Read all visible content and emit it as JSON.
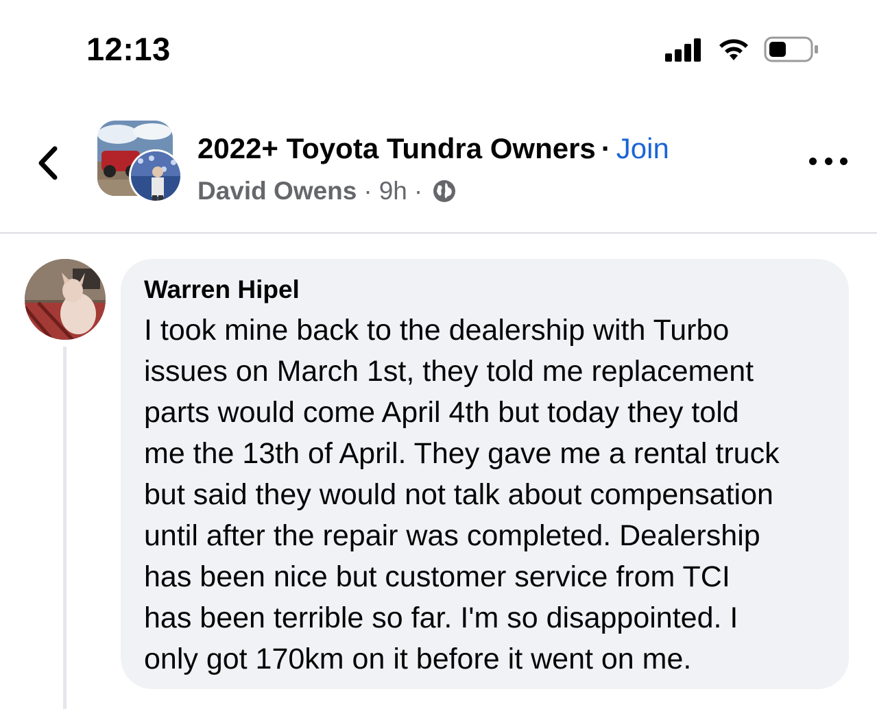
{
  "status_bar": {
    "time": "12:13"
  },
  "header": {
    "group_name": "2022+ Toyota Tundra Owners",
    "separator": "·",
    "join_label": "Join",
    "author": "David Owens",
    "time_ago": "9h",
    "icons": {
      "back": "chevron-left-icon",
      "privacy": "globe-icon",
      "more": "more-dots-icon"
    }
  },
  "comment": {
    "author": "Warren Hipel",
    "text": "I took mine back to the dealership with Turbo\nissues on March 1st, they told me replacement\nparts would come April 4th but today they told\nme the 13th of April. They gave me a rental truck\nbut said they would not talk about compensation\nuntil after the repair was completed.  Dealership\nhas been nice but customer service from TCI\nhas been terrible so far. I'm so disappointed. I\nonly got 170km on it before it went on me."
  },
  "colors": {
    "join": "#1b64d6",
    "secondary_text": "#65676b",
    "bubble_bg": "#f0f2f5"
  }
}
